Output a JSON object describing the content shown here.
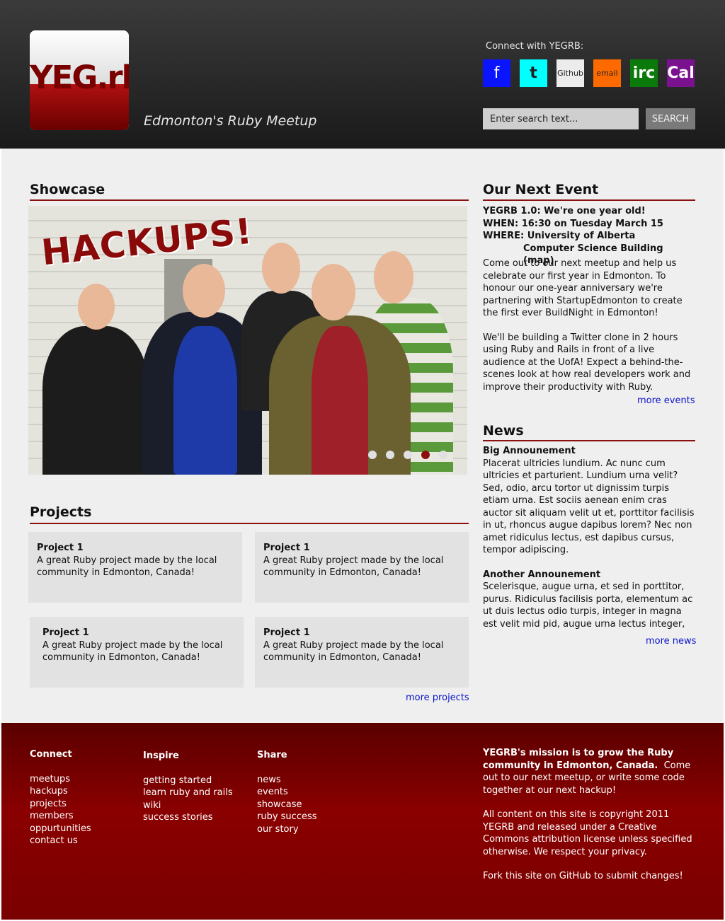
{
  "site": {
    "logo_text": "YEG.rb",
    "tagline": "Edmonton's Ruby Meetup"
  },
  "header": {
    "connect_label": "Connect with YEGRB:",
    "social": [
      {
        "label": "f",
        "name": "facebook",
        "color": "#0a14ff"
      },
      {
        "label": "t",
        "name": "twitter",
        "color": "#00ffff"
      },
      {
        "label": "Github",
        "name": "github",
        "color": "#ececec"
      },
      {
        "label": "email",
        "name": "email",
        "color": "#ff6a00"
      },
      {
        "label": "irc",
        "name": "irc",
        "color": "#0a7a0a"
      },
      {
        "label": "Cal",
        "name": "calendar",
        "color": "#7a1290"
      }
    ],
    "search_placeholder": "Enter search text...",
    "search_button": "SEARCH"
  },
  "showcase": {
    "title": "Showcase",
    "image_caption": "HACKUPS!",
    "slides": 5,
    "active_slide": 4
  },
  "event": {
    "title": "Our Next Event",
    "name": "YEGRB 1.0: We're one year old!",
    "when": "WHEN: 16:30 on Tuesday March 15",
    "where_label": "WHERE: University of Alberta",
    "where_detail": "Computer Science Building (map)",
    "paragraph1": "Come out to our next meetup and help us celebrate our first year in Edmonton. To honour our one-year anniversary we're partnering with StartupEdmonton to create the first ever BuildNight in Edmonton!",
    "paragraph2": "We'll be building a Twitter clone in 2 hours using Ruby and Rails in front of a live audience at the UofA! Expect a behind-the-scenes look at how real developers work and improve their productivity with Ruby.",
    "more_link": "more events"
  },
  "news": {
    "title": "News",
    "items": [
      {
        "heading": "Big Announement",
        "body": "Placerat ultricies lundium. Ac nunc cum ultricies et parturient. Lundium urna velit? Sed, odio, arcu tortor ut dignissim turpis etiam urna. Est sociis aenean enim cras auctor sit aliquam velit ut et, porttitor facilisis in ut, rhoncus augue dapibus lorem? Nec non amet ridiculus lectus, est dapibus cursus, tempor adipiscing."
      },
      {
        "heading": "Another Announement",
        "body": "Scelerisque, augue urna, et sed in porttitor, purus. Ridiculus facilisis porta, elementum ac ut duis lectus odio turpis, integer in magna est velit mid pid, augue urna lectus integer,"
      }
    ],
    "more_link": "more news"
  },
  "projects": {
    "title": "Projects",
    "items": [
      {
        "title": "Project 1",
        "desc": "A great Ruby project made by the local community in Edmonton, Canada!"
      },
      {
        "title": "Project 1",
        "desc": "A great Ruby project made by the local community in Edmonton, Canada!"
      },
      {
        "title": "Project 1",
        "desc": "A great Ruby project made by the local community in Edmonton, Canada!"
      },
      {
        "title": "Project 1",
        "desc": "A great Ruby project made by the local community in Edmonton, Canada!"
      }
    ],
    "more_link": "more projects"
  },
  "footer": {
    "connect": {
      "heading": "Connect",
      "links": [
        "meetups",
        "hackups",
        "projects",
        "members",
        "oppurtunities",
        "contact us"
      ]
    },
    "inspire": {
      "heading": "Inspire",
      "links": [
        "getting started",
        "learn ruby and rails",
        "wiki",
        "success stories"
      ]
    },
    "share": {
      "heading": "Share",
      "links": [
        "news",
        "events",
        "showcase",
        "ruby success",
        "our story"
      ]
    },
    "mission_bold": "YEGRB's mission is to grow the Ruby community in Edmonton, Canada.",
    "mission_rest": "Come out to our next meetup, or write some code together at our next hackup!",
    "copyright": "All content on this site is copyright 2011 YEGRB and released under a Creative Commons attribution license unless specified otherwise. We respect your privacy.",
    "fork": "Fork this site on GitHub to submit changes!"
  }
}
